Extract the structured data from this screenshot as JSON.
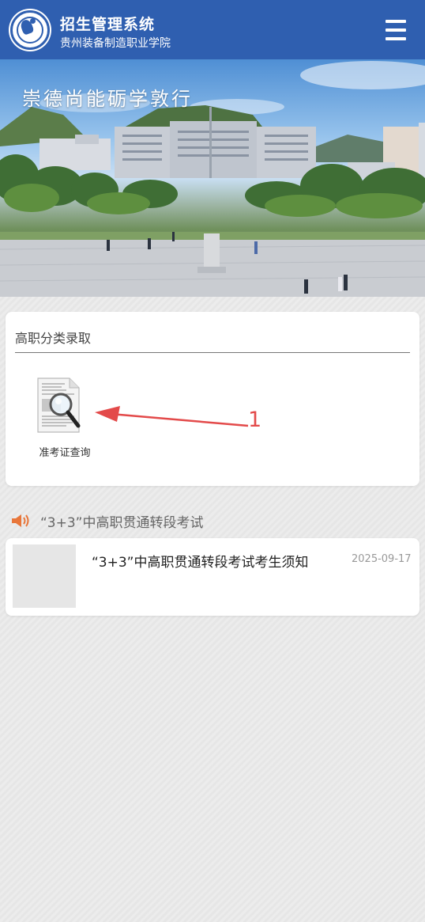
{
  "header": {
    "title": "招生管理系统",
    "subtitle": "贵州装备制造职业学院",
    "menu_icon": "hamburger-menu-icon",
    "logo": "school-logo",
    "bg_color": "#2f5fb0"
  },
  "banner": {
    "slogan": "崇德尚能砺学敦行"
  },
  "section": {
    "heading": "高职分类录取",
    "items": [
      {
        "label": "准考证查询",
        "icon": "document-search-icon"
      }
    ]
  },
  "annotation": {
    "number": "1",
    "color": "#e34a4a"
  },
  "notice": {
    "icon": "speaker-icon",
    "title": "“3+3”中高职贯通转段考试",
    "accent": "#e8763a"
  },
  "news": [
    {
      "title": "“3+3”中高职贯通转段考试考生须知",
      "date": "2025-09-17"
    }
  ]
}
